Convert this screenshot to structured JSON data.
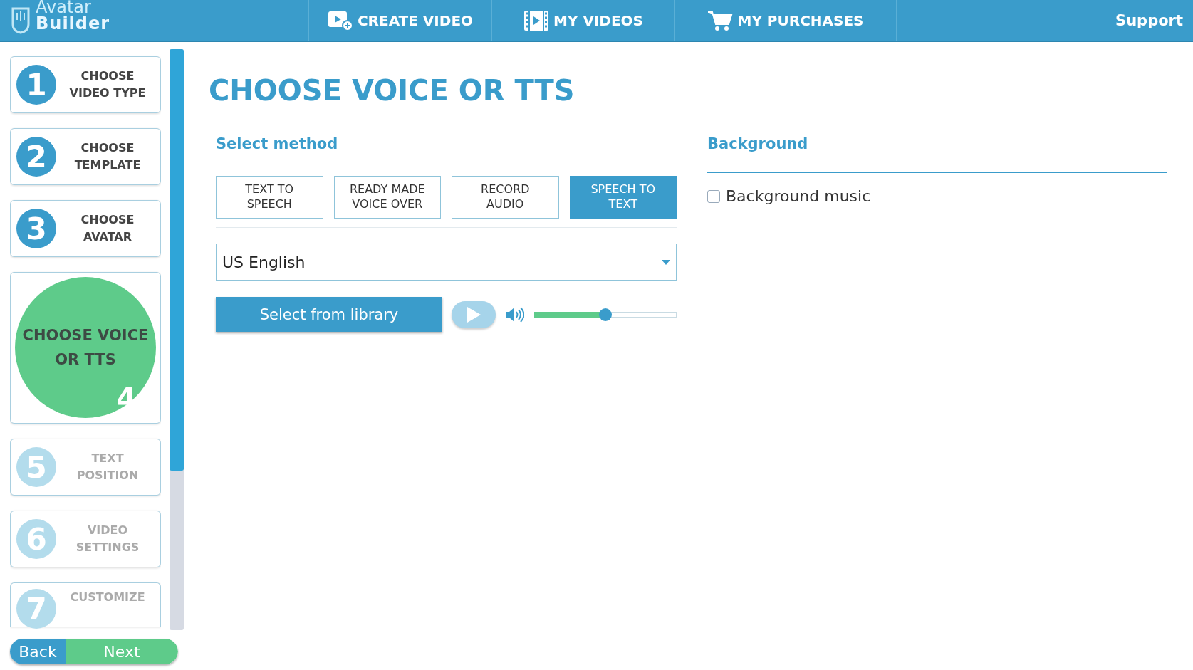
{
  "header": {
    "logo": {
      "line1": "Avatar",
      "line2": "Builder"
    },
    "nav": [
      {
        "label": "CREATE VIDEO"
      },
      {
        "label": "MY VIDEOS"
      },
      {
        "label": "MY PURCHASES"
      }
    ],
    "support": "Support"
  },
  "steps": [
    {
      "number": "1",
      "label": "CHOOSE VIDEO TYPE",
      "selected": false,
      "disabled": false
    },
    {
      "number": "2",
      "label": "CHOOSE TEMPLATE",
      "selected": false,
      "disabled": false
    },
    {
      "number": "3",
      "label": "CHOOSE AVATAR",
      "selected": false,
      "disabled": false
    },
    {
      "number": "4",
      "label": "CHOOSE VOICE OR TTS",
      "selected": true,
      "disabled": false
    },
    {
      "number": "5",
      "label": "TEXT POSITION",
      "selected": false,
      "disabled": true
    },
    {
      "number": "6",
      "label": "VIDEO SETTINGS",
      "selected": false,
      "disabled": true
    },
    {
      "number": "7",
      "label": "CUSTOMIZE",
      "selected": false,
      "disabled": true
    }
  ],
  "footer_buttons": {
    "back": "Back",
    "next": "Next"
  },
  "page_title": "CHOOSE VOICE OR TTS",
  "method": {
    "heading": "Select method",
    "tabs": [
      {
        "label": "TEXT TO SPEECH",
        "selected": false
      },
      {
        "label": "READY MADE VOICE OVER",
        "selected": false
      },
      {
        "label": "RECORD AUDIO",
        "selected": false
      },
      {
        "label": "SPEECH TO TEXT",
        "selected": true
      }
    ],
    "language": "US English",
    "library_button": "Select from library",
    "volume": {
      "level": 0.5
    }
  },
  "background": {
    "heading": "Background",
    "music": {
      "label": "Background music",
      "checked": false
    }
  }
}
